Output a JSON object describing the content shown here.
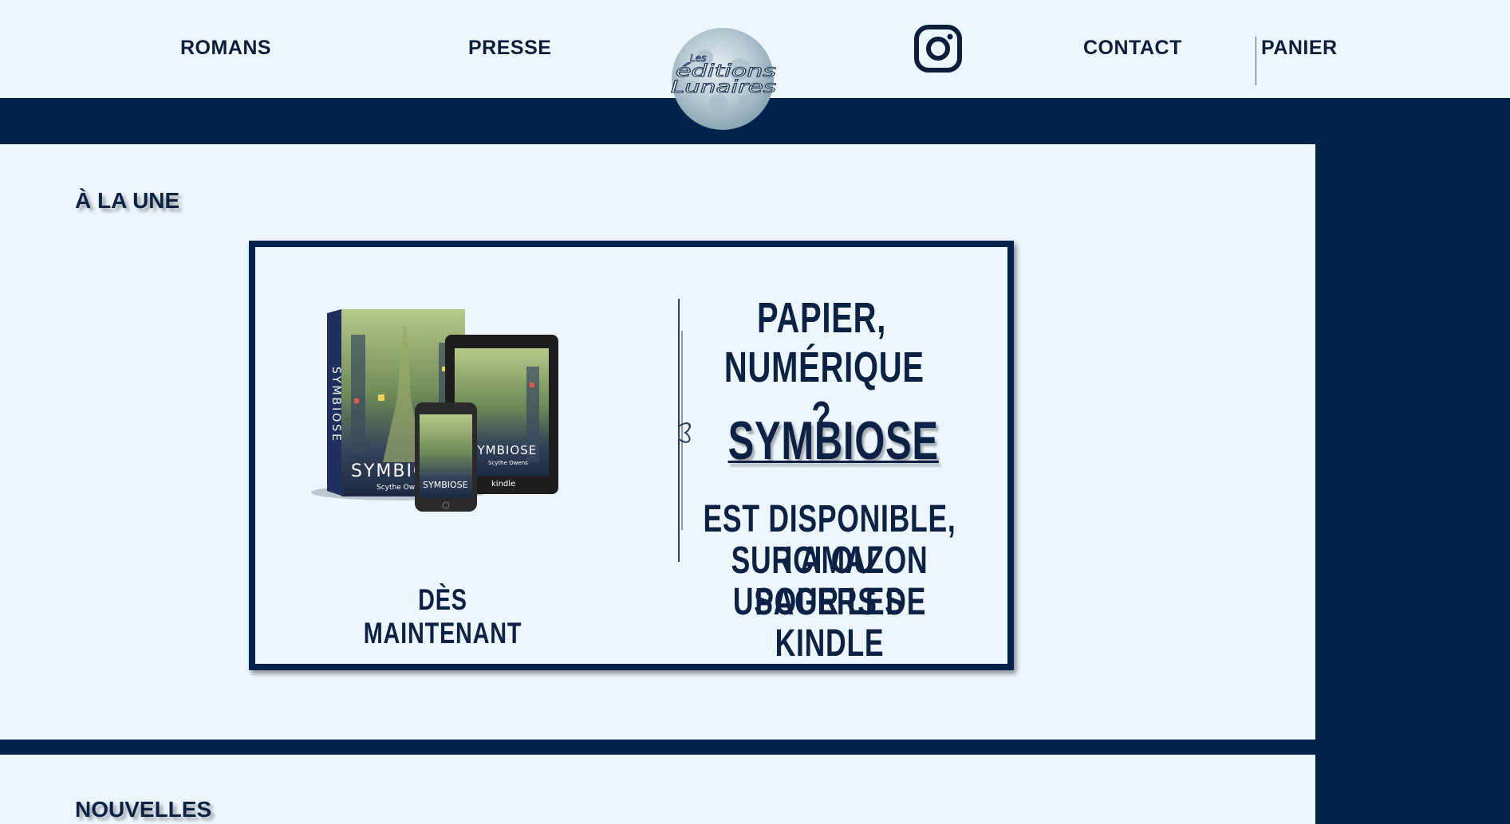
{
  "nav": {
    "romans": "ROMANS",
    "presse": "PRESSE",
    "contact": "CONTACT",
    "panier": "PANIER"
  },
  "logo": {
    "line1": "Les",
    "line2": "éditions",
    "line3": "Lunaires"
  },
  "icons": {
    "instagram": "instagram-icon"
  },
  "featured": {
    "title": "À LA UNE",
    "banner": {
      "left_caption": "DÈS MAINTENANT",
      "q1": "PAPIER,",
      "q2": "NUMÉRIQUE ?",
      "book_title": "SYMBIOSE",
      "avail1": "EST DISPONIBLE, ICI OU",
      "avail2": "SUR AMAZON POUR LES",
      "avail3": "USAGERS DE KINDLE",
      "cover_title": "SYMBIOSE",
      "cover_author": "Scythe Owens",
      "spine": "SYMBIOSE",
      "kindle": "kindle"
    }
  },
  "news": {
    "title": "NOUVELLES"
  },
  "colors": {
    "navy": "#00224b",
    "background": "#edf6fd",
    "text": "#0c2244"
  }
}
